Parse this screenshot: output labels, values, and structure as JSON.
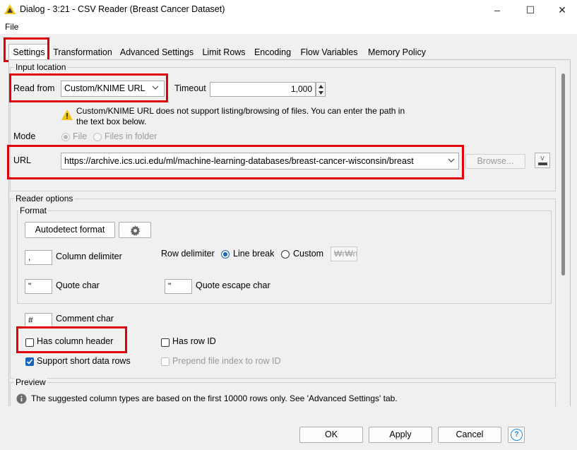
{
  "window": {
    "title": "Dialog - 3:21 - CSV Reader (Breast Cancer Dataset)",
    "minimize": "–",
    "maximize": "☐",
    "close": "✕"
  },
  "menu": {
    "file": "File"
  },
  "tabs": [
    {
      "label": "Settings"
    },
    {
      "label": "Transformation"
    },
    {
      "label": "Advanced Settings"
    },
    {
      "label": "Limit Rows"
    },
    {
      "label": "Encoding"
    },
    {
      "label": "Flow Variables"
    },
    {
      "label": "Memory Policy"
    }
  ],
  "input_location": {
    "group_title": "Input location",
    "read_from_label": "Read from",
    "read_from_value": "Custom/KNIME URL",
    "timeout_label": "Timeout",
    "timeout_value": "1,000",
    "warning_line1": "Custom/KNIME URL does not support listing/browsing of files. You can enter the path in",
    "warning_line2": "the text box below.",
    "mode_label": "Mode",
    "mode_file": "File",
    "mode_folder": "Files in folder",
    "url_label": "URL",
    "url_value": "https://archive.ics.uci.edu/ml/machine-learning-databases/breast-cancer-wisconsin/breast",
    "browse_label": "Browse..."
  },
  "reader_options": {
    "group_title": "Reader options",
    "format_title": "Format",
    "autodetect_label": "Autodetect format",
    "column_delimiter_value": ",",
    "column_delimiter_label": "Column delimiter",
    "row_delimiter_label": "Row delimiter",
    "line_break_label": "Line break",
    "custom_label": "Custom",
    "custom_value": "₩r₩n",
    "quote_char_value": "\"",
    "quote_char_label": "Quote char",
    "quote_escape_value": "\"",
    "quote_escape_label": "Quote escape char",
    "comment_char_value": "#",
    "comment_char_label": "Comment char",
    "has_column_header": "Has column header",
    "has_row_id": "Has row ID",
    "support_short_rows": "Support short data rows",
    "prepend_file_index": "Prepend file index to row ID"
  },
  "preview": {
    "group_title": "Preview",
    "info_text": "The suggested column types are based on the first 10000 rows only. See 'Advanced Settings' tab."
  },
  "footer": {
    "ok": "OK",
    "apply": "Apply",
    "cancel": "Cancel",
    "help": "?"
  },
  "colors": {
    "highlight_red": "#e0000a",
    "accent_blue": "#1565c0",
    "warning_yellow": "#f2c40f"
  }
}
